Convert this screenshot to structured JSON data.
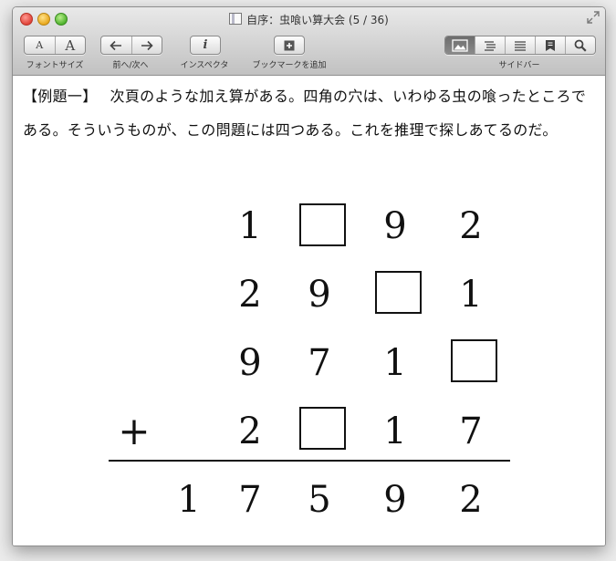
{
  "window": {
    "title": "自序：虫喰い算大会 (5 / 36)"
  },
  "toolbar": {
    "font_size": {
      "small_a": "A",
      "large_a": "A",
      "label": "フォントサイズ"
    },
    "prev_next": {
      "label": "前へ/次へ"
    },
    "inspector": {
      "glyph": "i",
      "label": "インスペクタ"
    },
    "bookmark": {
      "label": "ブックマークを追加"
    },
    "sidebar": {
      "label": "サイドバー"
    }
  },
  "content": {
    "paragraph_lead": "【例題一】",
    "paragraph_text": "次頁のような加え算がある。四角の穴は、いわゆる虫の喰ったところである。そういうものが、この問題には四つある。これを推理で探しあてるのだ。",
    "puzzle": {
      "row1": [
        "1",
        "",
        "9",
        "2"
      ],
      "row2": [
        "2",
        "9",
        "",
        "1"
      ],
      "row3": [
        "9",
        "7",
        "1",
        ""
      ],
      "row4": [
        "2",
        "",
        "1",
        "7"
      ],
      "plus": "+",
      "result": [
        "1",
        "7",
        "5",
        "9",
        "2"
      ]
    }
  },
  "colors": {
    "toolbar_top": "#e9e9e9",
    "toolbar_bottom": "#c1c1c1",
    "text": "#111111",
    "active_segment": "#6d6d6d"
  }
}
